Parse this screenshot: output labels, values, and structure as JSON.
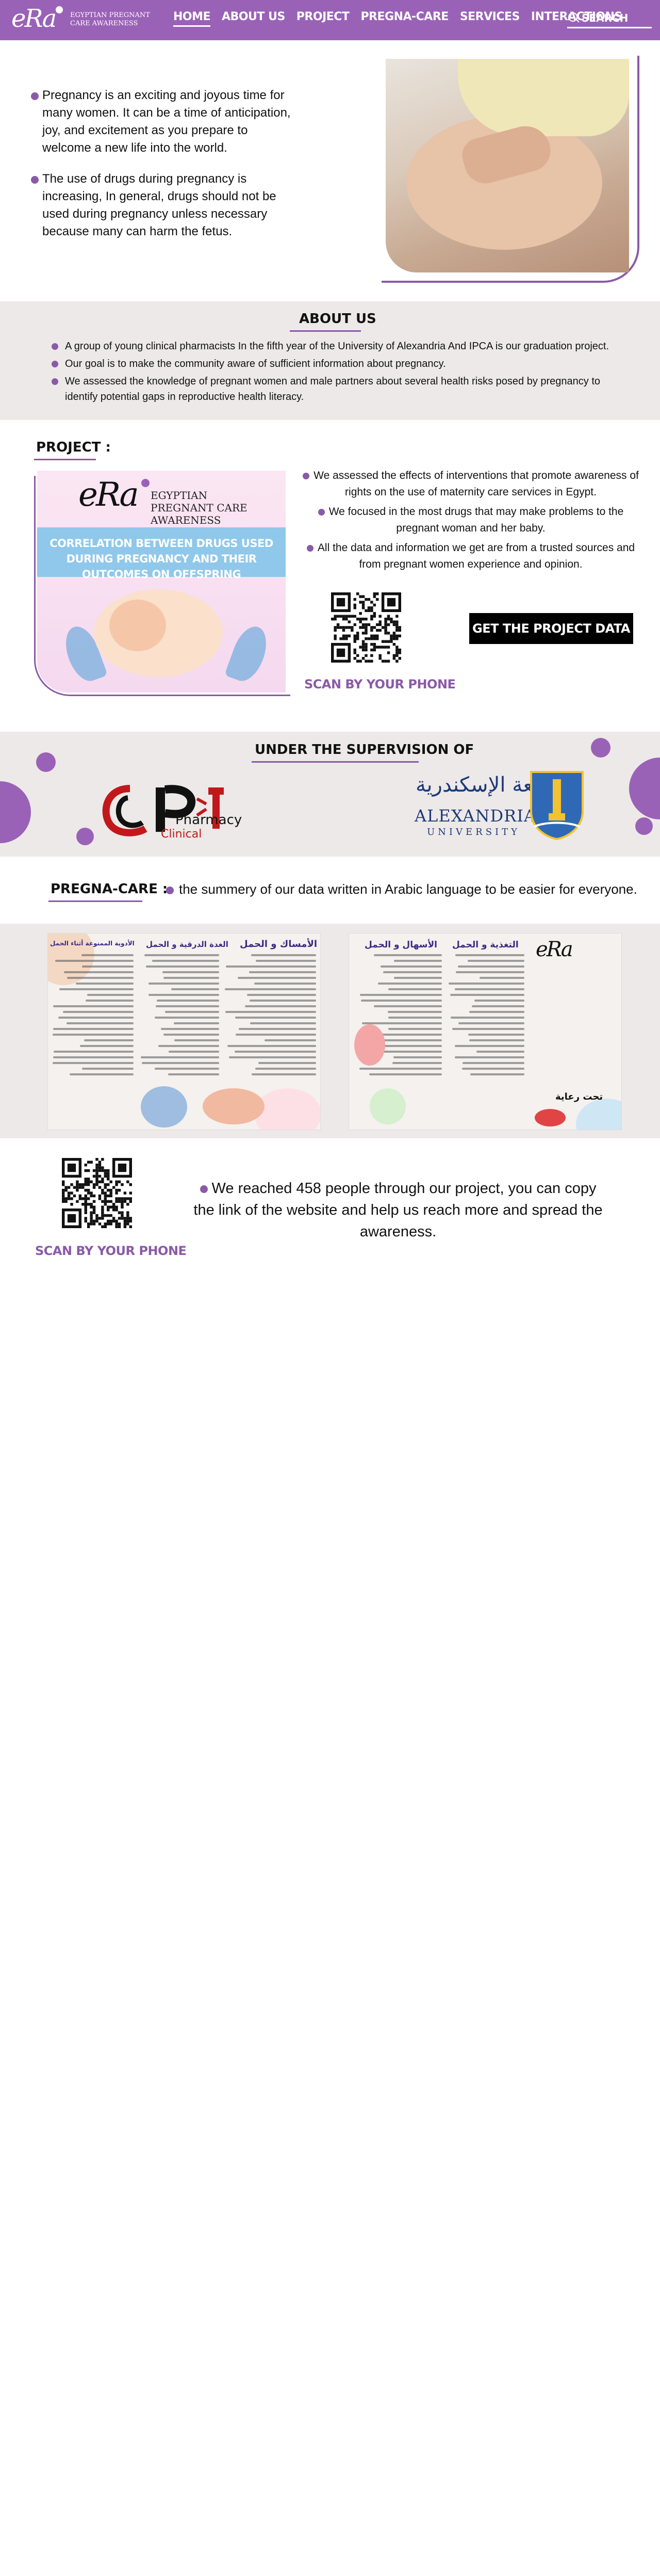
{
  "nav": {
    "logo_mark": "eRa",
    "logo_text": "EGYPTIAN PREGNANT CARE AWARENESS",
    "items": [
      {
        "label": "HOME",
        "active": true
      },
      {
        "label": "ABOUT US",
        "active": false
      },
      {
        "label": "PROJECT",
        "active": false
      },
      {
        "label": "PREGNA-CARE",
        "active": false
      },
      {
        "label": "SERVICES",
        "active": false
      },
      {
        "label": "INTERACTIONS",
        "active": false
      }
    ],
    "search_placeholder": "SEARCH"
  },
  "hero": {
    "paragraphs": [
      "Pregnancy is an exciting and joyous time for many women. It can be a time of anticipation, joy, and excitement as you prepare to welcome a new life into the world.",
      "The use of drugs during pregnancy is increasing, In general, drugs should not be used during pregnancy unless necessary because many can harm the fetus."
    ]
  },
  "about": {
    "title": "ABOUT US",
    "items": [
      "A group of young clinical pharmacists In the fifth year of the University of Alexandria And IPCA is our graduation project.",
      "Our goal is to make the community aware of sufficient information about pregnancy.",
      "We assessed the knowledge of pregnant women and male partners about several health risks posed by pregnancy to identify potential gaps in reproductive health literacy."
    ]
  },
  "project": {
    "title": "PROJECT :",
    "card_logo_mark": "eRa",
    "card_logo_text": "EGYPTIAN PREGNANT CARE AWARENESS",
    "card_banner": "CORRELATION BETWEEN DRUGS USED DURING PREGNANCY AND THEIR OUTCOMES ON OFFSPRING",
    "items": [
      "We assessed the effects of interventions that promote awareness of rights on the use of maternity care services in Egypt.",
      "We focused in the most drugs that may make problems to the pregnant woman and her baby.",
      "All the data and information we get are from a trusted sources and from pregnant women experience and opinion."
    ],
    "scan_label": "SCAN BY YOUR PHONE",
    "button_label": "GET THE PROJECT DATA"
  },
  "supervision": {
    "title": "UNDER THE SUPERVISION OF",
    "cp_text_1": "Pharmacy",
    "cp_text_2": "Clinical",
    "alex_arabic": "جامعة الإسكندرية",
    "alex_en_1": "ALEXANDRIA",
    "alex_en_2": "UNIVERSITY"
  },
  "pregna": {
    "title": "PREGNA-CARE :",
    "note": "the summery of our data written in Arabic language to be easier for everyone.",
    "flyer1_heads": [
      "الأمساك و الحمل",
      "الغدة الدرقية و الحمل",
      "الأدوية الممنوعة أثناء الحمل"
    ],
    "flyer2_heads": [
      "التغذية و الحمل",
      "الأسهال و الحمل",
      "تحت رعاية"
    ],
    "flyer2_logo": "eRa"
  },
  "reach": {
    "text": "We reached 458 people through our project, you can copy the link of the website and help us reach more and spread the awareness.",
    "scan_label": "SCAN BY YOUR PHONE"
  },
  "colors": {
    "accent": "#9a62b7",
    "band": "#ede9e8"
  }
}
